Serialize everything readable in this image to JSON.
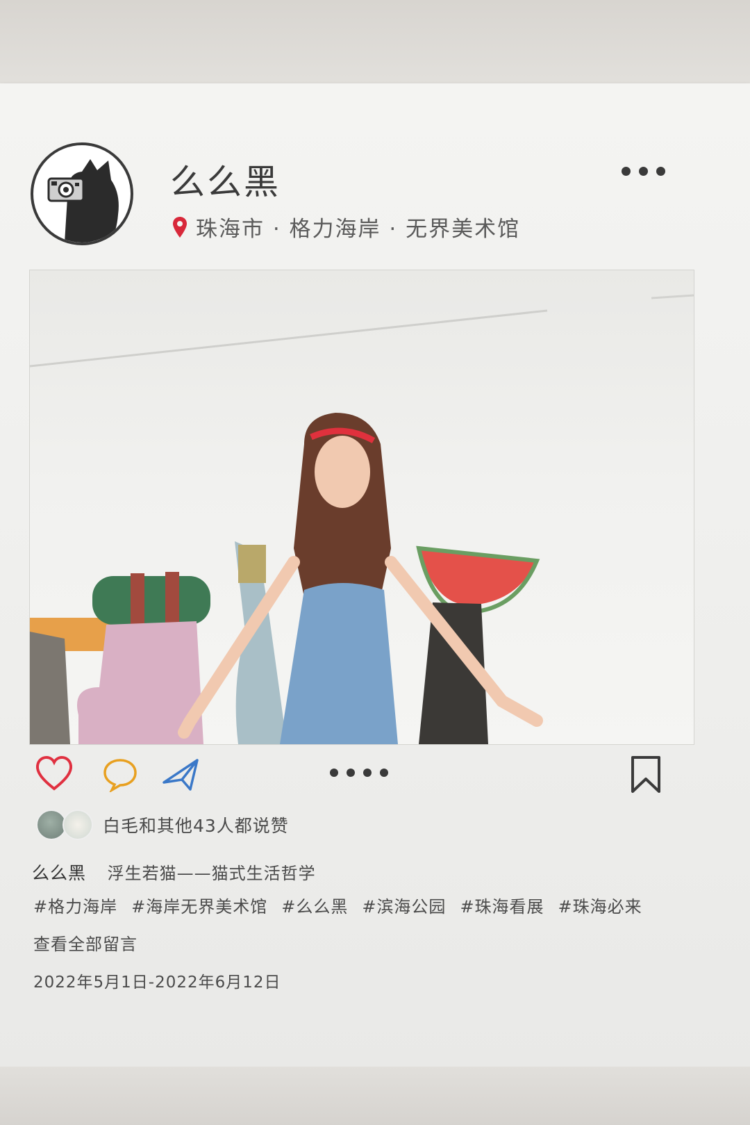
{
  "post": {
    "username": "么么黑",
    "location": "珠海市 · 格力海岸 · 无界美术馆"
  },
  "icons": {
    "more": "ellipsis-icon",
    "location": "map-pin-icon",
    "like": "heart-icon",
    "comment": "comment-bubble-icon",
    "share": "paper-plane-icon",
    "pager": "carousel-dots-icon",
    "save": "bookmark-icon"
  },
  "colors": {
    "like": "#e03040",
    "comment": "#e8a020",
    "share": "#3a78c8",
    "pin": "#d8283a"
  },
  "likes": {
    "text": "白毛和其他43人都说赞"
  },
  "caption": {
    "user": "么么黑",
    "text": "浮生若猫——猫式生活哲学"
  },
  "tags": [
    "#格力海岸",
    "#海岸无界美术馆",
    "#么么黑",
    "#滨海公园",
    "#珠海看展",
    "#珠海必来"
  ],
  "comments_link": "查看全部留言",
  "date": "2022年5月1日-2022年6月12日"
}
